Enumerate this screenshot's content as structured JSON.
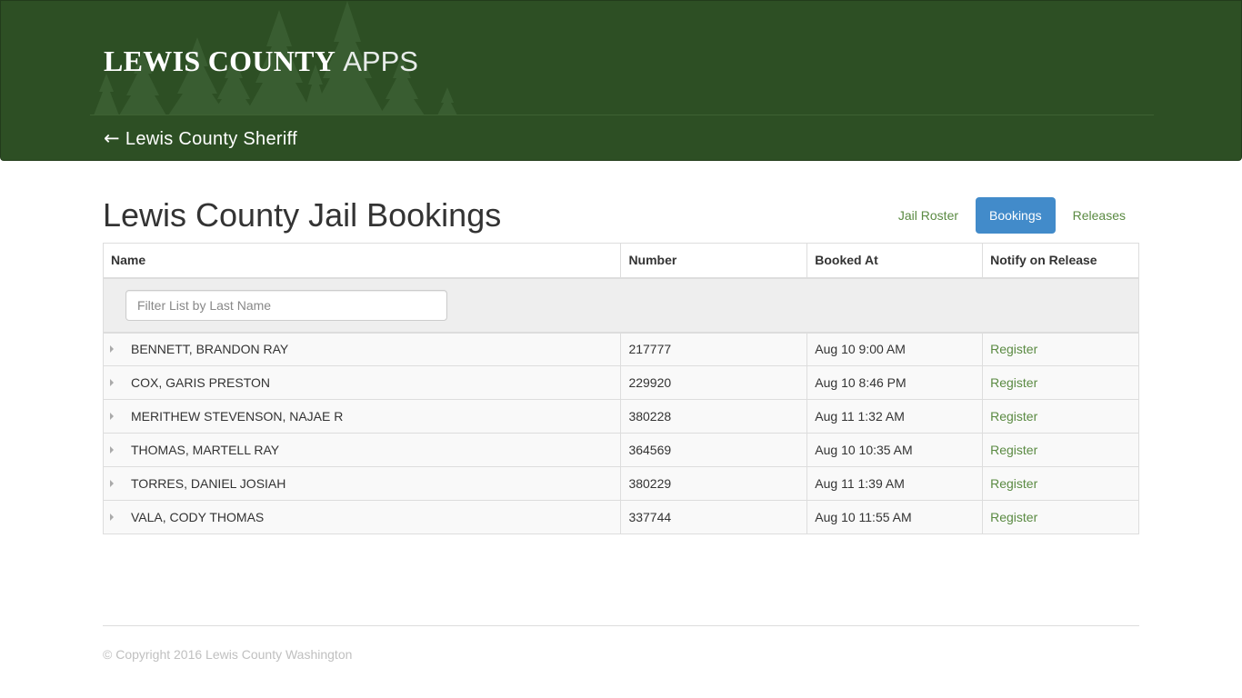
{
  "header": {
    "brand_name": "LEWIS COUNTY",
    "brand_suffix": "APPS",
    "back_arrow": "←",
    "back_link_label": "Lewis County Sheriff",
    "background_color": "#2d4f24"
  },
  "page": {
    "title": "Lewis County Jail Bookings"
  },
  "nav": {
    "items": [
      {
        "label": "Jail Roster",
        "active": false
      },
      {
        "label": "Bookings",
        "active": true
      },
      {
        "label": "Releases",
        "active": false
      }
    ],
    "active_color": "#428bca",
    "link_color": "#5a8a42"
  },
  "table": {
    "columns": [
      "Name",
      "Number",
      "Booked At",
      "Notify on Release"
    ],
    "filter_placeholder": "Filter List by Last Name",
    "filter_value": "",
    "rows": [
      {
        "name": "BENNETT, BRANDON RAY",
        "number": "217777",
        "booked_at": "Aug 10 9:00 AM",
        "action": "Register"
      },
      {
        "name": "COX, GARIS PRESTON",
        "number": "229920",
        "booked_at": "Aug 10 8:46 PM",
        "action": "Register"
      },
      {
        "name": "MERITHEW STEVENSON, NAJAE R",
        "number": "380228",
        "booked_at": "Aug 11 1:32 AM",
        "action": "Register"
      },
      {
        "name": "THOMAS, MARTELL RAY",
        "number": "364569",
        "booked_at": "Aug 10 10:35 AM",
        "action": "Register"
      },
      {
        "name": "TORRES, DANIEL JOSIAH",
        "number": "380229",
        "booked_at": "Aug 11 1:39 AM",
        "action": "Register"
      },
      {
        "name": "VALA, CODY THOMAS",
        "number": "337744",
        "booked_at": "Aug 10 11:55 AM",
        "action": "Register"
      }
    ]
  },
  "footer": {
    "copyright": "© Copyright 2016 Lewis County Washington"
  }
}
